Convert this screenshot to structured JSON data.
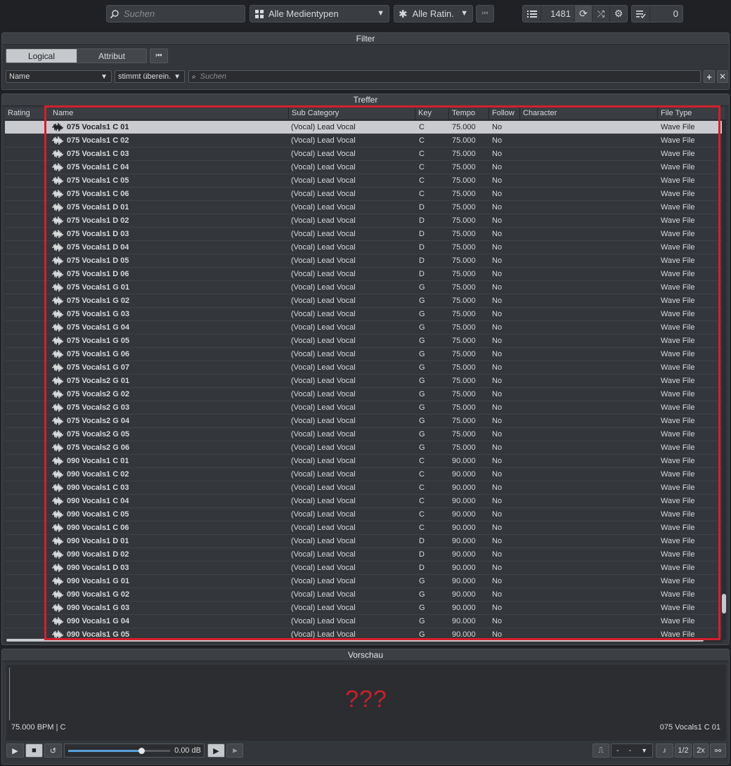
{
  "toolbar": {
    "search_placeholder": "Suchen",
    "media_type": "Alle Medientypen",
    "rating": "Alle Ratin.",
    "result_count": "1481",
    "selection_count": "0"
  },
  "filter": {
    "title": "Filter",
    "tab_logical": "Logical",
    "tab_attribut": "Attribut",
    "field_name": "Name",
    "condition": "stimmt überein.",
    "search_placeholder": "Suchen"
  },
  "results": {
    "title": "Treffer",
    "columns": {
      "rating": "Rating",
      "name": "Name",
      "sub_category": "Sub Category",
      "key": "Key",
      "tempo": "Tempo",
      "follow": "Follow",
      "character": "Character",
      "file_type": "File Type"
    },
    "rows": [
      {
        "name": "075 Vocals1 C 01",
        "sub": "(Vocal) Lead Vocal",
        "key": "C",
        "tempo": "75.000",
        "follow": "No",
        "type": "Wave File"
      },
      {
        "name": "075 Vocals1 C 02",
        "sub": "(Vocal) Lead Vocal",
        "key": "C",
        "tempo": "75.000",
        "follow": "No",
        "type": "Wave File"
      },
      {
        "name": "075 Vocals1 C 03",
        "sub": "(Vocal) Lead Vocal",
        "key": "C",
        "tempo": "75.000",
        "follow": "No",
        "type": "Wave File"
      },
      {
        "name": "075 Vocals1 C 04",
        "sub": "(Vocal) Lead Vocal",
        "key": "C",
        "tempo": "75.000",
        "follow": "No",
        "type": "Wave File"
      },
      {
        "name": "075 Vocals1 C 05",
        "sub": "(Vocal) Lead Vocal",
        "key": "C",
        "tempo": "75.000",
        "follow": "No",
        "type": "Wave File"
      },
      {
        "name": "075 Vocals1 C 06",
        "sub": "(Vocal) Lead Vocal",
        "key": "C",
        "tempo": "75.000",
        "follow": "No",
        "type": "Wave File"
      },
      {
        "name": "075 Vocals1 D 01",
        "sub": "(Vocal) Lead Vocal",
        "key": "D",
        "tempo": "75.000",
        "follow": "No",
        "type": "Wave File"
      },
      {
        "name": "075 Vocals1 D 02",
        "sub": "(Vocal) Lead Vocal",
        "key": "D",
        "tempo": "75.000",
        "follow": "No",
        "type": "Wave File"
      },
      {
        "name": "075 Vocals1 D 03",
        "sub": "(Vocal) Lead Vocal",
        "key": "D",
        "tempo": "75.000",
        "follow": "No",
        "type": "Wave File"
      },
      {
        "name": "075 Vocals1 D 04",
        "sub": "(Vocal) Lead Vocal",
        "key": "D",
        "tempo": "75.000",
        "follow": "No",
        "type": "Wave File"
      },
      {
        "name": "075 Vocals1 D 05",
        "sub": "(Vocal) Lead Vocal",
        "key": "D",
        "tempo": "75.000",
        "follow": "No",
        "type": "Wave File"
      },
      {
        "name": "075 Vocals1 D 06",
        "sub": "(Vocal) Lead Vocal",
        "key": "D",
        "tempo": "75.000",
        "follow": "No",
        "type": "Wave File"
      },
      {
        "name": "075 Vocals1 G 01",
        "sub": "(Vocal) Lead Vocal",
        "key": "G",
        "tempo": "75.000",
        "follow": "No",
        "type": "Wave File"
      },
      {
        "name": "075 Vocals1 G 02",
        "sub": "(Vocal) Lead Vocal",
        "key": "G",
        "tempo": "75.000",
        "follow": "No",
        "type": "Wave File"
      },
      {
        "name": "075 Vocals1 G 03",
        "sub": "(Vocal) Lead Vocal",
        "key": "G",
        "tempo": "75.000",
        "follow": "No",
        "type": "Wave File"
      },
      {
        "name": "075 Vocals1 G 04",
        "sub": "(Vocal) Lead Vocal",
        "key": "G",
        "tempo": "75.000",
        "follow": "No",
        "type": "Wave File"
      },
      {
        "name": "075 Vocals1 G 05",
        "sub": "(Vocal) Lead Vocal",
        "key": "G",
        "tempo": "75.000",
        "follow": "No",
        "type": "Wave File"
      },
      {
        "name": "075 Vocals1 G 06",
        "sub": "(Vocal) Lead Vocal",
        "key": "G",
        "tempo": "75.000",
        "follow": "No",
        "type": "Wave File"
      },
      {
        "name": "075 Vocals1 G 07",
        "sub": "(Vocal) Lead Vocal",
        "key": "G",
        "tempo": "75.000",
        "follow": "No",
        "type": "Wave File"
      },
      {
        "name": "075 Vocals2 G 01",
        "sub": "(Vocal) Lead Vocal",
        "key": "G",
        "tempo": "75.000",
        "follow": "No",
        "type": "Wave File"
      },
      {
        "name": "075 Vocals2 G 02",
        "sub": "(Vocal) Lead Vocal",
        "key": "G",
        "tempo": "75.000",
        "follow": "No",
        "type": "Wave File"
      },
      {
        "name": "075 Vocals2 G 03",
        "sub": "(Vocal) Lead Vocal",
        "key": "G",
        "tempo": "75.000",
        "follow": "No",
        "type": "Wave File"
      },
      {
        "name": "075 Vocals2 G 04",
        "sub": "(Vocal) Lead Vocal",
        "key": "G",
        "tempo": "75.000",
        "follow": "No",
        "type": "Wave File"
      },
      {
        "name": "075 Vocals2 G 05",
        "sub": "(Vocal) Lead Vocal",
        "key": "G",
        "tempo": "75.000",
        "follow": "No",
        "type": "Wave File"
      },
      {
        "name": "075 Vocals2 G 06",
        "sub": "(Vocal) Lead Vocal",
        "key": "G",
        "tempo": "75.000",
        "follow": "No",
        "type": "Wave File"
      },
      {
        "name": "090 Vocals1 C 01",
        "sub": "(Vocal) Lead Vocal",
        "key": "C",
        "tempo": "90.000",
        "follow": "No",
        "type": "Wave File"
      },
      {
        "name": "090 Vocals1 C 02",
        "sub": "(Vocal) Lead Vocal",
        "key": "C",
        "tempo": "90.000",
        "follow": "No",
        "type": "Wave File"
      },
      {
        "name": "090 Vocals1 C 03",
        "sub": "(Vocal) Lead Vocal",
        "key": "C",
        "tempo": "90.000",
        "follow": "No",
        "type": "Wave File"
      },
      {
        "name": "090 Vocals1 C 04",
        "sub": "(Vocal) Lead Vocal",
        "key": "C",
        "tempo": "90.000",
        "follow": "No",
        "type": "Wave File"
      },
      {
        "name": "090 Vocals1 C 05",
        "sub": "(Vocal) Lead Vocal",
        "key": "C",
        "tempo": "90.000",
        "follow": "No",
        "type": "Wave File"
      },
      {
        "name": "090 Vocals1 C 06",
        "sub": "(Vocal) Lead Vocal",
        "key": "C",
        "tempo": "90.000",
        "follow": "No",
        "type": "Wave File"
      },
      {
        "name": "090 Vocals1 D 01",
        "sub": "(Vocal) Lead Vocal",
        "key": "D",
        "tempo": "90.000",
        "follow": "No",
        "type": "Wave File"
      },
      {
        "name": "090 Vocals1 D 02",
        "sub": "(Vocal) Lead Vocal",
        "key": "D",
        "tempo": "90.000",
        "follow": "No",
        "type": "Wave File"
      },
      {
        "name": "090 Vocals1 D 03",
        "sub": "(Vocal) Lead Vocal",
        "key": "D",
        "tempo": "90.000",
        "follow": "No",
        "type": "Wave File"
      },
      {
        "name": "090 Vocals1 G 01",
        "sub": "(Vocal) Lead Vocal",
        "key": "G",
        "tempo": "90.000",
        "follow": "No",
        "type": "Wave File"
      },
      {
        "name": "090 Vocals1 G 02",
        "sub": "(Vocal) Lead Vocal",
        "key": "G",
        "tempo": "90.000",
        "follow": "No",
        "type": "Wave File"
      },
      {
        "name": "090 Vocals1 G 03",
        "sub": "(Vocal) Lead Vocal",
        "key": "G",
        "tempo": "90.000",
        "follow": "No",
        "type": "Wave File"
      },
      {
        "name": "090 Vocals1 G 04",
        "sub": "(Vocal) Lead Vocal",
        "key": "G",
        "tempo": "90.000",
        "follow": "No",
        "type": "Wave File"
      },
      {
        "name": "090 Vocals1 G 05",
        "sub": "(Vocal) Lead Vocal",
        "key": "G",
        "tempo": "90.000",
        "follow": "No",
        "type": "Wave File"
      }
    ]
  },
  "preview": {
    "title": "Vorschau",
    "placeholder": "???",
    "bpm_key": "75.000 BPM | C",
    "file_name": "075 Vocals1 C 01",
    "volume": "0.00 dB",
    "volume_level": 0.72,
    "rate": "1/2",
    "speed": "2x",
    "pitch_left": "-",
    "pitch_right": "-"
  },
  "colors": {
    "highlight": "#d4202a",
    "volume_fill": "#5aa0d8"
  }
}
